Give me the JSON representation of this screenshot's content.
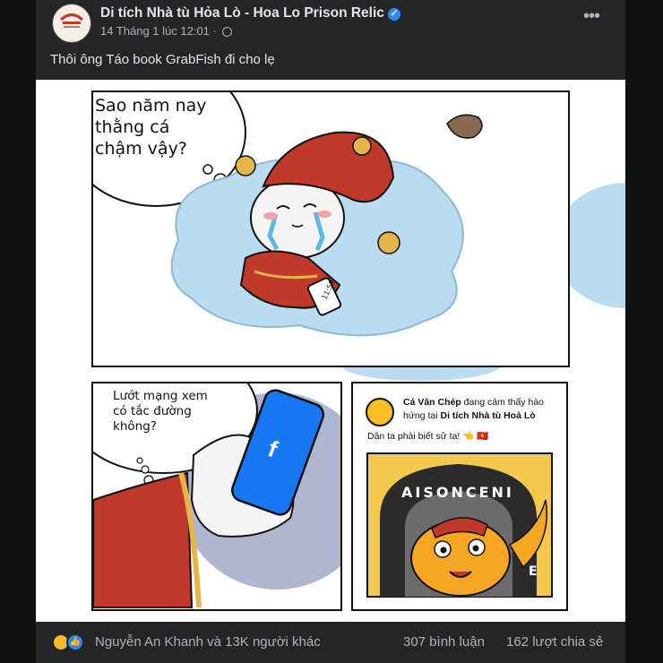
{
  "post": {
    "page_name": "Di tích Nhà tù Hỏa Lò - Hoa Lo Prison Relic",
    "timestamp": "14 Tháng 1 lúc 12:01 ·",
    "caption": "Thôi ông Táo book GrabFish đi cho lẹ",
    "more_icon": "more-horizontal-icon",
    "privacy_icon": "globe-icon"
  },
  "comic": {
    "panel1_bubble": "Sao năm nay\nthằng cá\nchậm vậy?",
    "phone_time": "11:59",
    "panel2_bubble": "Lướt mạng xem\ncó tắc đường\nkhông?",
    "facebook_logo": "f",
    "notification": {
      "actor": "Cá Vân Chép",
      "action": " đang cảm thấy hào hứng tại ",
      "place": "Di tích Nhà tù Hoả Lò",
      "text": "Dân ta phải biết sử ta! 👈 🇻🇳"
    },
    "sign_text": "AISONCENI",
    "sign_letter": "E"
  },
  "footer": {
    "reactions_text": "Nguyễn An Khanh và 13K người khác",
    "comments": "307 bình luận",
    "shares": "162 lượt chia sẻ",
    "reaction_icons": [
      "haha-icon",
      "like-icon"
    ]
  },
  "colors": {
    "background": "#18191a",
    "card": "#242526",
    "primary_text": "#e4e6eb",
    "secondary_text": "#b0b3b8",
    "verified_blue": "#2d88ff",
    "emperor_red": "#c0392b",
    "cloud_blue": "#b9dcf0",
    "facebook_blue": "#1877f2"
  }
}
